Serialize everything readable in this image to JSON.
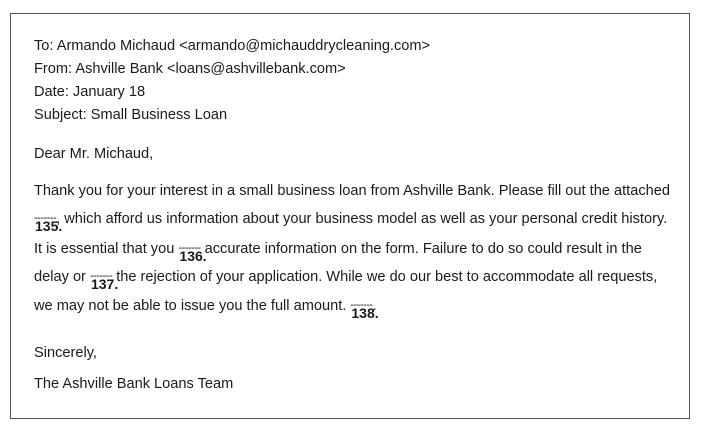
{
  "email": {
    "header": {
      "to": "To: Armando Michaud <armando@michauddrycleaning.com>",
      "from": "From: Ashville Bank <loans@ashvillebank.com>",
      "date": "Date: January 18",
      "subject": "Subject: Small Business Loan"
    },
    "greeting": "Dear Mr. Michaud,",
    "body": {
      "line1": "Thank you for your interest in a small business loan from Ashville Bank. Please fill out the attached",
      "line2_after": ", which afford us information about your business model as well as your personal credit history.",
      "line3_before": "It is essential that you ",
      "line3_after": " accurate information on the form. Failure to do so could result in the",
      "line4_before": "delay or ",
      "line4_after": " the rejection of your application. While we do our best to accommodate all requests,",
      "line5_before": "we may not be able to issue you the full amount. ",
      "line5_after": "."
    },
    "blanks": {
      "dash": "-------",
      "q135": "135.",
      "q136": "136.",
      "q137": "137.",
      "q138": "138."
    },
    "closing": "Sincerely,",
    "signature": "The Ashville Bank Loans Team"
  }
}
